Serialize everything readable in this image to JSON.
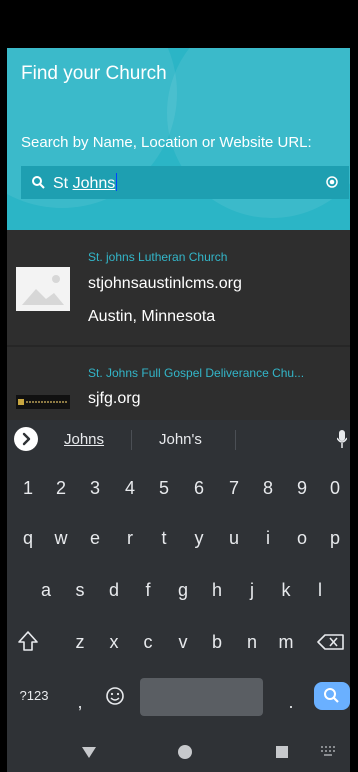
{
  "header": {
    "title": "Find your Church",
    "subtitle": "Search by Name, Location or Website URL:"
  },
  "search": {
    "value_prefix": "St ",
    "value_underlined": "Johns"
  },
  "results": [
    {
      "name": "St. johns Lutheran Church",
      "website": "stjohnsaustinlcms.org",
      "location": "Austin, Minnesota"
    },
    {
      "name": "St. Johns Full Gospel Deliverance Chu...",
      "website": "sjfg.org"
    }
  ],
  "keyboard": {
    "suggestions": [
      "Johns",
      "John's"
    ],
    "numbers": [
      "1",
      "2",
      "3",
      "4",
      "5",
      "6",
      "7",
      "8",
      "9",
      "0"
    ],
    "row1": [
      "q",
      "w",
      "e",
      "r",
      "t",
      "y",
      "u",
      "i",
      "o",
      "p"
    ],
    "row2": [
      "a",
      "s",
      "d",
      "f",
      "g",
      "h",
      "j",
      "k",
      "l"
    ],
    "row3": [
      "z",
      "x",
      "c",
      "v",
      "b",
      "n",
      "m"
    ],
    "symbols_key": "?123",
    "comma_key": ",",
    "period_key": "."
  },
  "colors": {
    "header_bg": "#2bb5c6",
    "accent_text": "#33b6c9",
    "keyboard_bg": "#2f3236",
    "enter_key": "#6ab0ff"
  }
}
